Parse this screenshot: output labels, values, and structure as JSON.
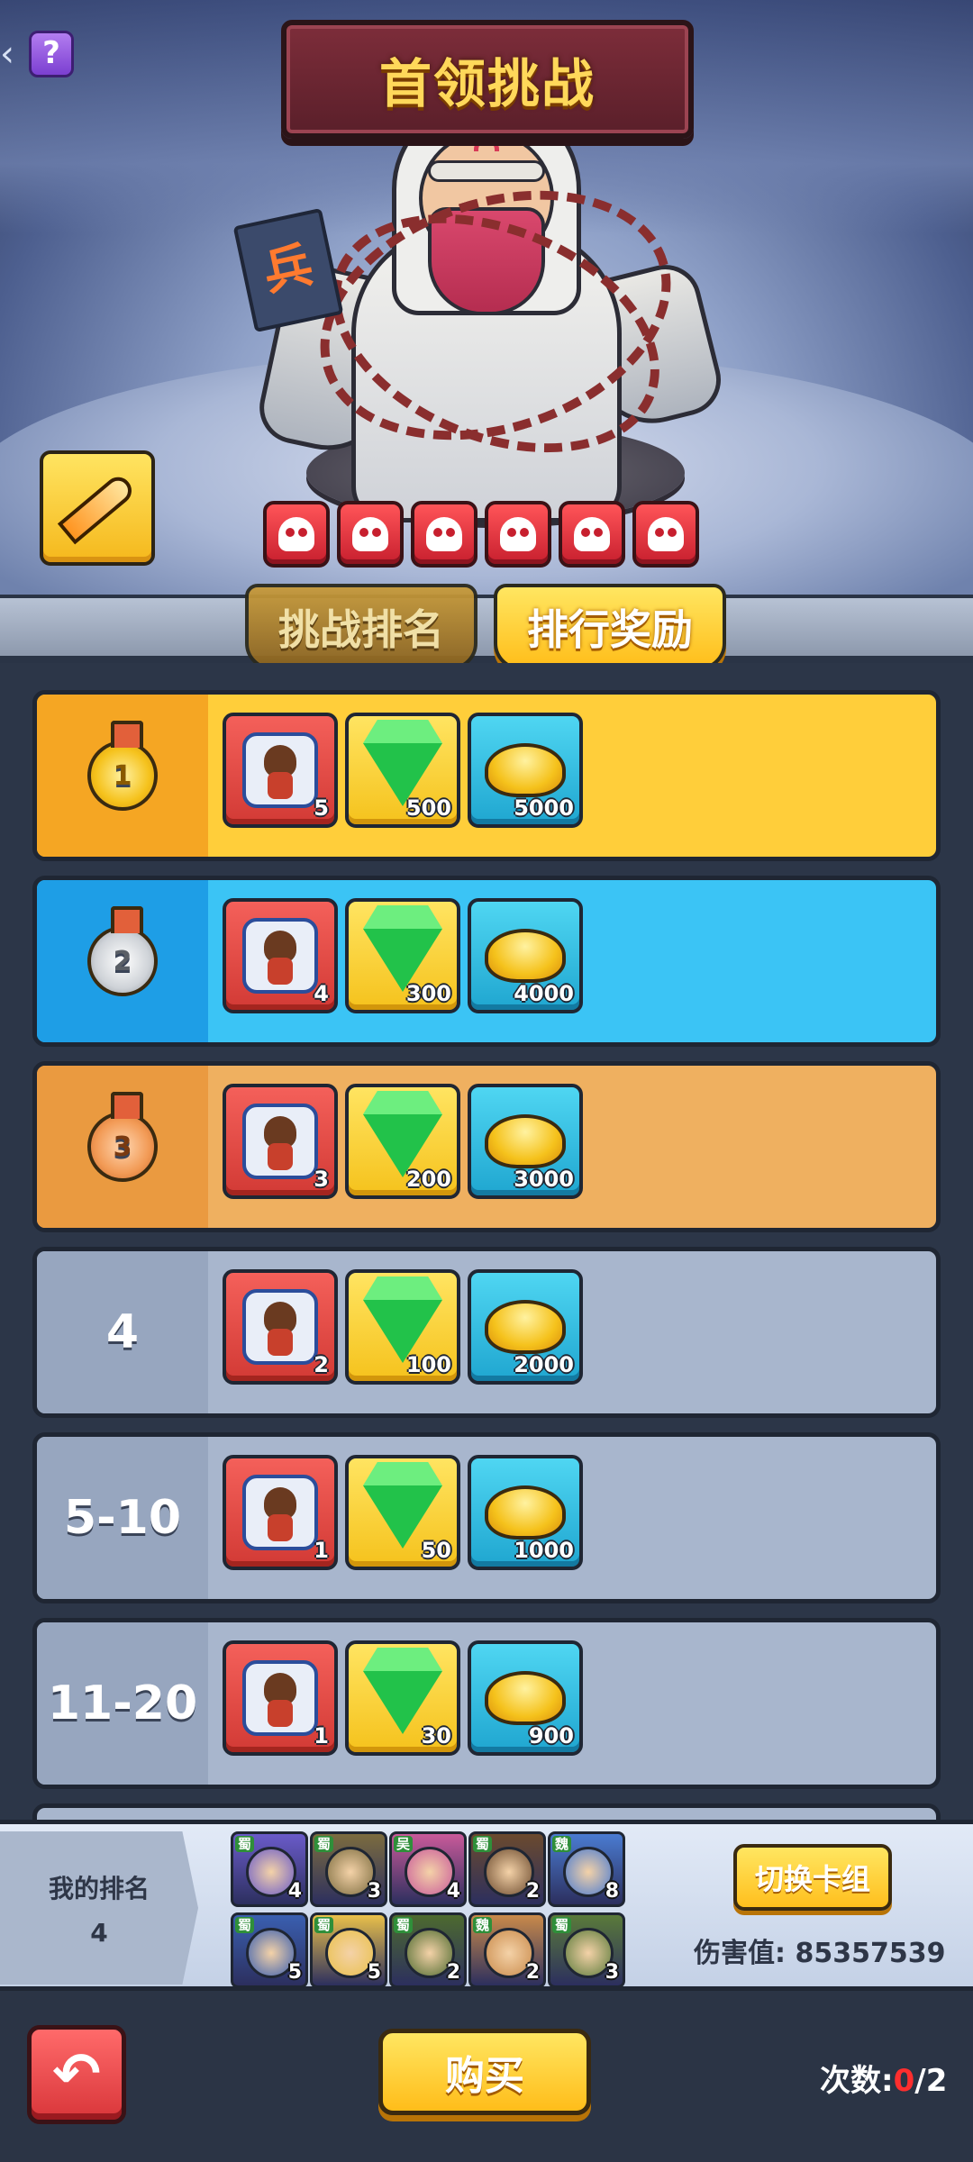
{
  "header": {
    "title": "首领挑战",
    "help_glyph": "?"
  },
  "boss": {
    "book_glyph": "兵"
  },
  "relic_icon": "sword-relic-icon",
  "skull_count": 6,
  "tabs": [
    {
      "label": "挑战排名",
      "active": false
    },
    {
      "label": "排行奖励",
      "active": true
    }
  ],
  "rewards": [
    {
      "rank": "1",
      "medal": "gold",
      "row_color": "#ffce3a",
      "rank_bg": "#f5a623",
      "items": [
        "5",
        "500",
        "5000"
      ]
    },
    {
      "rank": "2",
      "medal": "silver",
      "row_color": "#3bc4f5",
      "rank_bg": "#1e9ee6",
      "items": [
        "4",
        "300",
        "4000"
      ]
    },
    {
      "rank": "3",
      "medal": "bronze",
      "row_color": "#efb060",
      "rank_bg": "#ea9a40",
      "items": [
        "3",
        "200",
        "3000"
      ]
    },
    {
      "rank": "4",
      "medal": "",
      "row_color": "#a8b6cd",
      "rank_bg": "#97a6bf",
      "items": [
        "2",
        "100",
        "2000"
      ]
    },
    {
      "rank": "5-10",
      "medal": "",
      "row_color": "#a8b6cd",
      "rank_bg": "#97a6bf",
      "items": [
        "1",
        "50",
        "1000"
      ]
    },
    {
      "rank": "11-20",
      "medal": "",
      "row_color": "#a8b6cd",
      "rank_bg": "#97a6bf",
      "items": [
        "1",
        "30",
        "900"
      ]
    }
  ],
  "my_rank": {
    "label": "我的排名",
    "value": "4"
  },
  "team": [
    {
      "faction": "蜀",
      "count": "4",
      "color": "#6a5bc9"
    },
    {
      "faction": "蜀",
      "count": "3",
      "color": "#7c6c3f"
    },
    {
      "faction": "吴",
      "count": "4",
      "color": "#c95a9a"
    },
    {
      "faction": "蜀",
      "count": "2",
      "color": "#6b4a2e"
    },
    {
      "faction": "魏",
      "count": "8",
      "color": "#4a7bd1"
    },
    {
      "faction": "蜀",
      "count": "5",
      "color": "#3a5fb0"
    },
    {
      "faction": "蜀",
      "count": "5",
      "color": "#e9c04a"
    },
    {
      "faction": "蜀",
      "count": "2",
      "color": "#4d6a2f"
    },
    {
      "faction": "魏",
      "count": "2",
      "color": "#c98a4a"
    },
    {
      "faction": "蜀",
      "count": "3",
      "color": "#5a7a3a"
    }
  ],
  "switch_deck_label": "切换卡组",
  "damage": {
    "label": "伤害值:",
    "value": "85357539"
  },
  "buy_label": "购买",
  "attempts": {
    "label": "次数:",
    "used": "0",
    "total": "/2"
  },
  "back_icon": "return-arrow-icon"
}
